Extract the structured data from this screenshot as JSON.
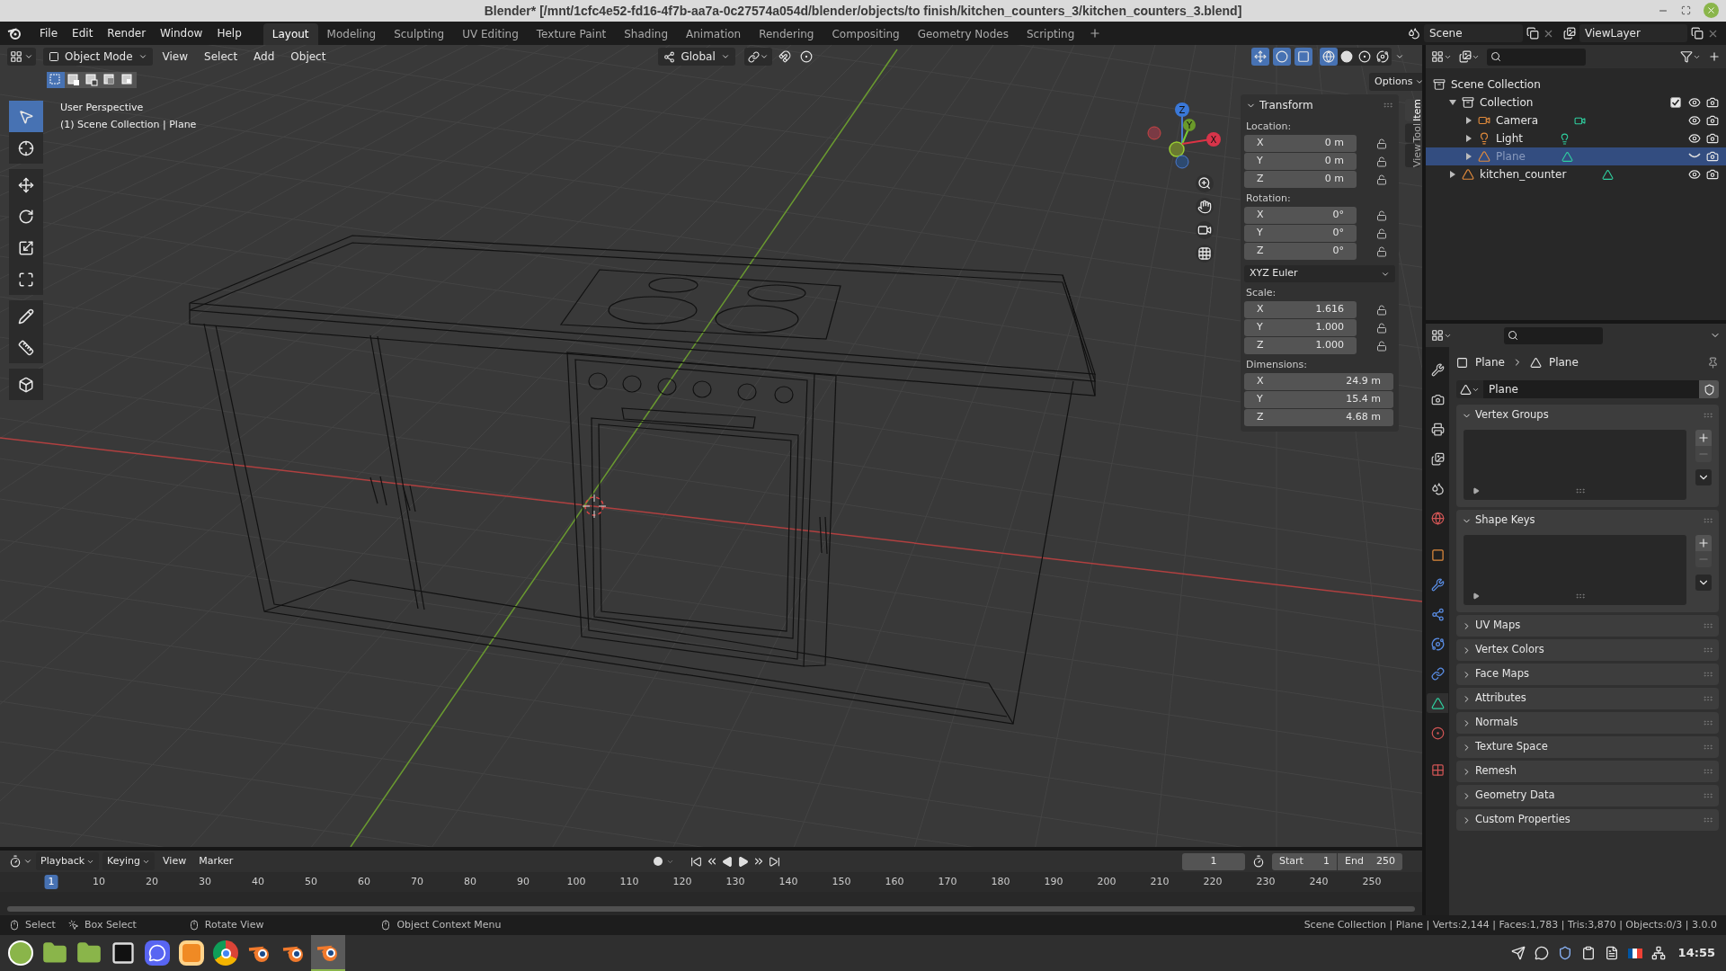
{
  "window": {
    "title": "Blender* [/mnt/1cfc4e52-fd16-4f7b-aa7a-0c27574a054d/blender/objects/to finish/kitchen_counters_3/kitchen_counters_3.blend]"
  },
  "menu": [
    "File",
    "Edit",
    "Render",
    "Window",
    "Help"
  ],
  "workspaces": [
    {
      "label": "Layout",
      "selected": true
    },
    {
      "label": "Modeling",
      "selected": false
    },
    {
      "label": "Sculpting",
      "selected": false
    },
    {
      "label": "UV Editing",
      "selected": false
    },
    {
      "label": "Texture Paint",
      "selected": false
    },
    {
      "label": "Shading",
      "selected": false
    },
    {
      "label": "Animation",
      "selected": false
    },
    {
      "label": "Rendering",
      "selected": false
    },
    {
      "label": "Compositing",
      "selected": false
    },
    {
      "label": "Geometry Nodes",
      "selected": false
    },
    {
      "label": "Scripting",
      "selected": false
    }
  ],
  "scene": "Scene",
  "view_layer": "ViewLayer",
  "viewport": {
    "mode": "Object Mode",
    "menus": [
      "View",
      "Select",
      "Add",
      "Object"
    ],
    "orientation": "Global",
    "options": "Options",
    "select_modes": [
      {
        "kind": "set",
        "selected": true
      },
      {
        "kind": "extend",
        "selected": false
      },
      {
        "kind": "subtract",
        "selected": false
      },
      {
        "kind": "invert",
        "selected": false
      },
      {
        "kind": "intersect",
        "selected": false
      }
    ],
    "toggles": [
      {
        "kind": "snap",
        "on": false
      },
      {
        "kind": "proportional",
        "on": false
      },
      {
        "kind": "gizmos",
        "on": true
      },
      {
        "kind": "overlays",
        "on": true
      },
      {
        "kind": "xray",
        "on": true
      }
    ],
    "shading": [
      {
        "kind": "wireframe",
        "selected": true
      },
      {
        "kind": "solid",
        "selected": false
      },
      {
        "kind": "material",
        "selected": false
      },
      {
        "kind": "rendered",
        "selected": false
      }
    ],
    "overlay_text": [
      "User Perspective",
      "(1) Scene Collection | Plane"
    ],
    "gizmo_axes": [
      "Z",
      "Y",
      "X"
    ],
    "tools": [
      {
        "kind": "select",
        "selected": true
      },
      {
        "kind": "cursor",
        "selected": false
      },
      {
        "kind": "move",
        "selected": false
      },
      {
        "kind": "rotate",
        "selected": false
      },
      {
        "kind": "scale",
        "selected": false
      },
      {
        "kind": "transform",
        "selected": false
      },
      {
        "kind": "annotate",
        "selected": false
      },
      {
        "kind": "measure",
        "selected": false
      },
      {
        "kind": "add-cube",
        "selected": false
      }
    ]
  },
  "sidebar": {
    "tabs": [
      {
        "label": "Item",
        "selected": true
      },
      {
        "label": "Tool",
        "selected": false
      },
      {
        "label": "View",
        "selected": false
      }
    ],
    "panel_title": "Transform",
    "groups": [
      {
        "kind": "lockable",
        "label": "Location:",
        "rows": [
          {
            "axis": "X",
            "value": "0 m"
          },
          {
            "axis": "Y",
            "value": "0 m"
          },
          {
            "axis": "Z",
            "value": "0 m"
          }
        ]
      },
      {
        "kind": "lockable",
        "label": "Rotation:",
        "rows": [
          {
            "axis": "X",
            "value": "0°"
          },
          {
            "axis": "Y",
            "value": "0°"
          },
          {
            "axis": "Z",
            "value": "0°"
          }
        ]
      },
      {
        "kind": "dropdown",
        "value": "XYZ Euler"
      },
      {
        "kind": "lockable",
        "label": "Scale:",
        "rows": [
          {
            "axis": "X",
            "value": "1.616"
          },
          {
            "axis": "Y",
            "value": "1.000"
          },
          {
            "axis": "Z",
            "value": "1.000"
          }
        ]
      },
      {
        "kind": "plain",
        "label": "Dimensions:",
        "rows": [
          {
            "axis": "X",
            "value": "24.9 m"
          },
          {
            "axis": "Y",
            "value": "15.4 m"
          },
          {
            "axis": "Z",
            "value": "4.68 m"
          }
        ]
      }
    ]
  },
  "outliner": {
    "items": [
      {
        "label": "Scene Collection",
        "kind": "scene",
        "children": [
          {
            "label": "Collection",
            "kind": "collection",
            "expanded": true,
            "checked": true,
            "selected": false,
            "hidden": false,
            "children": [
              {
                "label": "Camera",
                "kind": "camera",
                "expanded": false,
                "selected": false,
                "hidden": false
              },
              {
                "label": "Light",
                "kind": "light",
                "expanded": false,
                "selected": false,
                "hidden": false
              },
              {
                "label": "Plane",
                "kind": "mesh",
                "expanded": false,
                "selected": true,
                "hidden": true
              }
            ]
          },
          {
            "label": "kitchen_counter",
            "kind": "mesh",
            "expanded": false,
            "selected": false,
            "hidden": false
          }
        ]
      }
    ]
  },
  "properties": {
    "tabs": [
      {
        "kind": "tool",
        "selected": false
      },
      {
        "kind": "render",
        "selected": false
      },
      {
        "kind": "output",
        "selected": false
      },
      {
        "kind": "view-layer",
        "selected": false
      },
      {
        "kind": "scene",
        "selected": false
      },
      {
        "kind": "world",
        "selected": false
      },
      {
        "kind": "object",
        "selected": false
      },
      {
        "kind": "modifiers",
        "selected": false
      },
      {
        "kind": "particles",
        "selected": false
      },
      {
        "kind": "physics",
        "selected": false
      },
      {
        "kind": "constraints",
        "selected": false
      },
      {
        "kind": "data",
        "selected": true
      },
      {
        "kind": "material",
        "selected": false
      },
      {
        "kind": "texture",
        "selected": false
      }
    ],
    "breadcrumb": [
      "Plane",
      "Plane"
    ],
    "data_name": "Plane",
    "panels": [
      {
        "title": "Vertex Groups",
        "expanded": true
      },
      {
        "title": "Shape Keys",
        "expanded": true
      },
      {
        "title": "UV Maps",
        "expanded": false
      },
      {
        "title": "Vertex Colors",
        "expanded": false
      },
      {
        "title": "Face Maps",
        "expanded": false
      },
      {
        "title": "Attributes",
        "expanded": false
      },
      {
        "title": "Normals",
        "expanded": false
      },
      {
        "title": "Texture Space",
        "expanded": false
      },
      {
        "title": "Remesh",
        "expanded": false
      },
      {
        "title": "Geometry Data",
        "expanded": false
      },
      {
        "title": "Custom Properties",
        "expanded": false
      }
    ]
  },
  "timeline": {
    "menus": [
      {
        "label": "Playback",
        "dropdown": true
      },
      {
        "label": "Keying",
        "dropdown": true
      },
      {
        "label": "View",
        "dropdown": false
      },
      {
        "label": "Marker",
        "dropdown": false
      }
    ],
    "current_frame": "1",
    "start_label": "Start",
    "start": "1",
    "end_label": "End",
    "end": "250",
    "ruler": [
      {
        "label": "1",
        "selected": true
      },
      {
        "label": "10",
        "selected": false
      },
      {
        "label": "20",
        "selected": false
      },
      {
        "label": "30",
        "selected": false
      },
      {
        "label": "40",
        "selected": false
      },
      {
        "label": "50",
        "selected": false
      },
      {
        "label": "60",
        "selected": false
      },
      {
        "label": "70",
        "selected": false
      },
      {
        "label": "80",
        "selected": false
      },
      {
        "label": "90",
        "selected": false
      },
      {
        "label": "100",
        "selected": false
      },
      {
        "label": "110",
        "selected": false
      },
      {
        "label": "120",
        "selected": false
      },
      {
        "label": "130",
        "selected": false
      },
      {
        "label": "140",
        "selected": false
      },
      {
        "label": "150",
        "selected": false
      },
      {
        "label": "160",
        "selected": false
      },
      {
        "label": "170",
        "selected": false
      },
      {
        "label": "180",
        "selected": false
      },
      {
        "label": "190",
        "selected": false
      },
      {
        "label": "200",
        "selected": false
      },
      {
        "label": "210",
        "selected": false
      },
      {
        "label": "220",
        "selected": false
      },
      {
        "label": "230",
        "selected": false
      },
      {
        "label": "240",
        "selected": false
      },
      {
        "label": "250",
        "selected": false
      }
    ]
  },
  "status_bar": {
    "hints": [
      {
        "kind": "left",
        "label": "Select"
      },
      {
        "kind": "drag",
        "label": "Box Select"
      },
      {
        "kind": "middle",
        "label": "Rotate View"
      },
      {
        "kind": "right",
        "label": "Object Context Menu"
      }
    ],
    "stats": "Scene Collection | Plane | Verts:2,144 | Faces:1,783 | Tris:3,870 | Objects:0/3 | 3.0.0"
  },
  "taskbar": {
    "apps": [
      {
        "kind": "menu",
        "active": false
      },
      {
        "kind": "folder",
        "active": false
      },
      {
        "kind": "folder",
        "active": false
      },
      {
        "kind": "terminal",
        "active": false
      },
      {
        "kind": "chat",
        "active": false
      },
      {
        "kind": "orange",
        "active": false
      },
      {
        "kind": "browser",
        "active": false
      },
      {
        "kind": "blender",
        "active": false
      },
      {
        "kind": "blender",
        "active": false
      },
      {
        "kind": "blender",
        "active": true
      }
    ],
    "tray": [
      {
        "kind": "send"
      },
      {
        "kind": "chat"
      },
      {
        "kind": "shield"
      },
      {
        "kind": "clipboard"
      },
      {
        "kind": "note"
      },
      {
        "kind": "flag"
      },
      {
        "kind": "network"
      }
    ],
    "clock": "14:55"
  }
}
